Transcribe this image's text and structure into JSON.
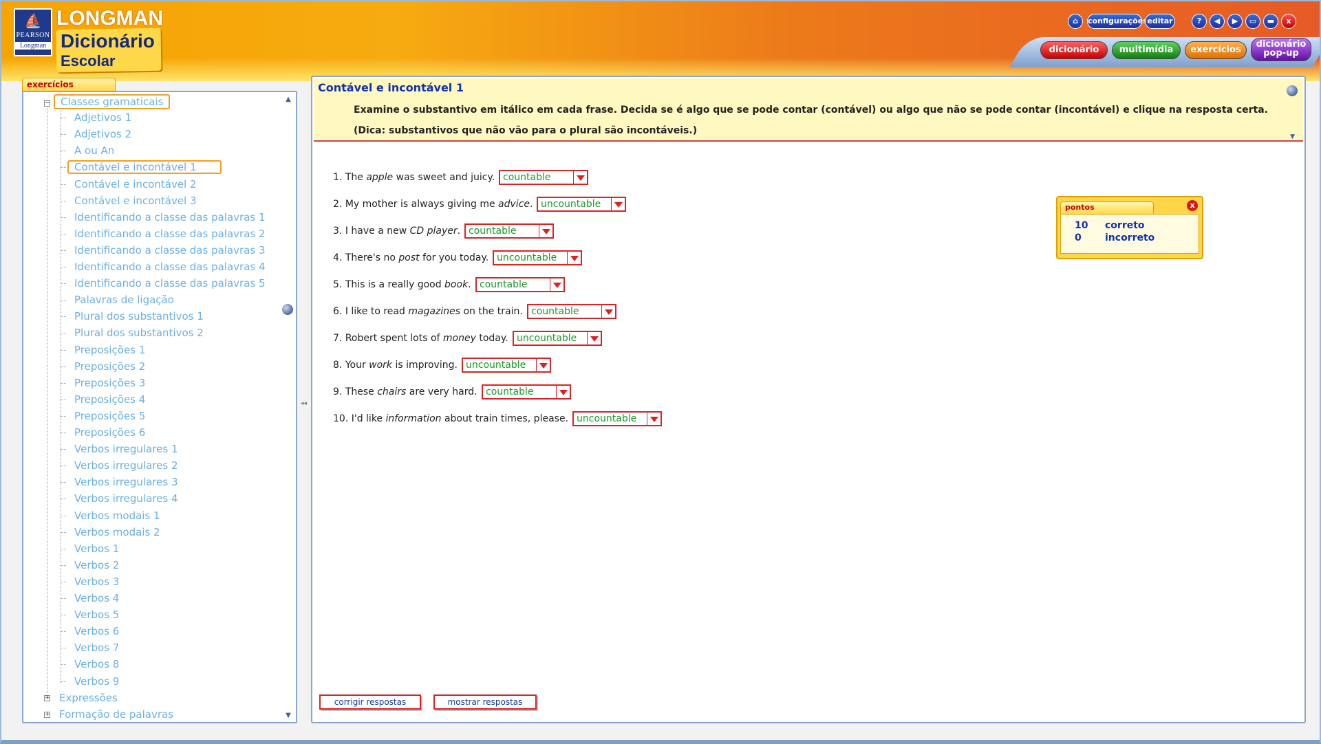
{
  "header": {
    "publisher_top": "PEARSON",
    "publisher_bottom": "Longman",
    "brand_line1": "LONGMAN",
    "brand_line2": "Dicionário",
    "brand_line3": "Escolar",
    "toolbar": {
      "home_icon": "home-icon",
      "configuracoes": "configurações",
      "editar": "editar",
      "help": "?",
      "back_icon": "arrow-left-icon",
      "forward_icon": "arrow-right-icon",
      "restore_icon": "restore-window-icon",
      "maximize_icon": "maximize-window-icon",
      "close": "x"
    },
    "main_tabs": [
      {
        "label": "dicionário",
        "color": "#d81818"
      },
      {
        "label": "multimídia",
        "color": "#18a018"
      },
      {
        "label": "exercícios",
        "color": "#f08a10"
      },
      {
        "label": "dicionário pop-up",
        "color": "#8020c0"
      }
    ]
  },
  "sidebar": {
    "tab_label": "exercícios",
    "tree": {
      "root_label": "Classes gramaticais",
      "items": [
        "Adjetivos 1",
        "Adjetivos 2",
        "A ou An",
        "Contável e incontável 1",
        "Contável e incontável 2",
        "Contável e incontável 3",
        "Identificando a classe das palavras 1",
        "Identificando a classe das palavras 2",
        "Identificando a classe das palavras 3",
        "Identificando a classe das palavras 4",
        "Identificando a classe das palavras 5",
        "Palavras de ligação",
        "Plural dos substantivos 1",
        "Plural dos substantivos 2",
        "Preposições 1",
        "Preposições 2",
        "Preposições 3",
        "Preposições 4",
        "Preposições 5",
        "Preposições 6",
        "Verbos irregulares 1",
        "Verbos irregulares 2",
        "Verbos irregulares 3",
        "Verbos irregulares 4",
        "Verbos modais 1",
        "Verbos modais 2",
        "Verbos 1",
        "Verbos 2",
        "Verbos 3",
        "Verbos 4",
        "Verbos 5",
        "Verbos 6",
        "Verbos 7",
        "Verbos 8",
        "Verbos 9"
      ],
      "selected_index": 3,
      "other_roots": [
        "Expressões",
        "Formação de palavras"
      ]
    }
  },
  "exercise": {
    "title": "Contável e incontável 1",
    "instruction1": "Examine o substantivo em itálico em cada frase. Decida se é algo que se pode contar (contável) ou algo que não se pode contar (incontável) e clique na resposta certa.",
    "instruction2": "(Dica: substantivos que não vão para o plural são incontáveis.)",
    "questions": [
      {
        "num": "1.",
        "before": "The ",
        "noun": "apple",
        "after": " was sweet and juicy.",
        "answer": "countable"
      },
      {
        "num": "2.",
        "before": "My mother is always giving me ",
        "noun": "advice",
        "after": ".",
        "answer": "uncountable"
      },
      {
        "num": "3.",
        "before": "I have a new ",
        "noun": "CD player",
        "after": ".",
        "answer": "countable"
      },
      {
        "num": "4.",
        "before": "There's no ",
        "noun": "post",
        "after": " for you today.",
        "answer": "uncountable"
      },
      {
        "num": "5.",
        "before": "This is a really good ",
        "noun": "book",
        "after": ".",
        "answer": "countable"
      },
      {
        "num": "6.",
        "before": "I like to read ",
        "noun": "magazines",
        "after": " on the train.",
        "answer": "countable"
      },
      {
        "num": "7.",
        "before": "Robert spent lots of ",
        "noun": "money",
        "after": " today.",
        "answer": "uncountable"
      },
      {
        "num": "8.",
        "before": "Your ",
        "noun": "work",
        "after": " is improving.",
        "answer": "uncountable"
      },
      {
        "num": "9.",
        "before": "These ",
        "noun": "chairs",
        "after": " are very hard.",
        "answer": "countable"
      },
      {
        "num": "10.",
        "before": "I'd like ",
        "noun": "information",
        "after": " about train times, please.",
        "answer": "uncountable"
      }
    ],
    "buttons": {
      "check": "corrigir respostas",
      "show": "mostrar respostas"
    }
  },
  "score": {
    "title": "pontos",
    "correct_count": "10",
    "correct_label": "correto",
    "incorrect_count": "0",
    "incorrect_label": "incorreto",
    "close": "x"
  }
}
